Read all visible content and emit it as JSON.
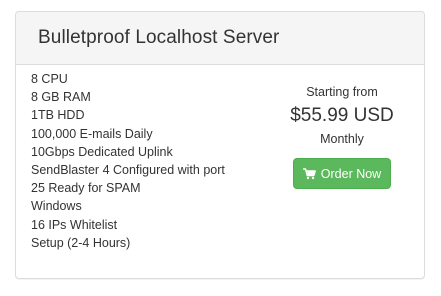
{
  "panel": {
    "title": "Bulletproof Localhost Server"
  },
  "features": [
    "8 CPU",
    "8 GB RAM",
    "1TB HDD",
    "100,000 E-mails Daily",
    "10Gbps Dedicated Uplink",
    "SendBlaster 4 Configured with port",
    "25 Ready for SPAM",
    "Windows",
    "16 IPs Whitelist",
    "Setup (2-4 Hours)"
  ],
  "pricing": {
    "starting_label": "Starting from",
    "price": "$55.99 USD",
    "cycle": "Monthly",
    "button_label": "Order Now",
    "button_icon": "shopping-cart-icon",
    "button_color": "#5cb85c"
  }
}
